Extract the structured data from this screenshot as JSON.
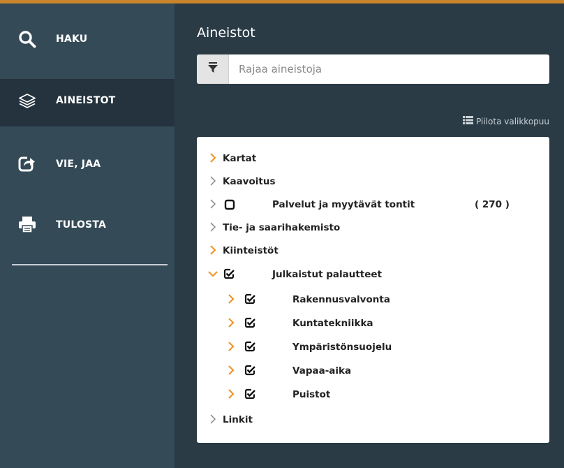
{
  "sidebar": {
    "items": [
      {
        "label": "HAKU",
        "icon": "search-icon"
      },
      {
        "label": "AINEISTOT",
        "icon": "layers-icon",
        "active": true
      },
      {
        "label": "VIE, JAA",
        "icon": "share-icon"
      },
      {
        "label": "TULOSTA",
        "icon": "print-icon"
      }
    ]
  },
  "main": {
    "title": "Aineistot",
    "filter": {
      "placeholder": "Rajaa aineistoja",
      "value": "",
      "icon": "filter-icon"
    },
    "hide_tree_label": "Piilota valikkopuu",
    "hide_tree_icon": "list-icon",
    "tree": [
      {
        "label": "Kartat",
        "expanded": false,
        "chevron": "orange"
      },
      {
        "label": "Kaavoitus",
        "expanded": false,
        "chevron": "gray"
      },
      {
        "label": "Palvelut ja myytävät tontit",
        "count": "( 270 )",
        "checked": false,
        "chevron": "gray"
      },
      {
        "label": "Tie- ja saarihakemisto",
        "chevron": "gray"
      },
      {
        "label": "Kiinteistöt",
        "chevron": "orange"
      },
      {
        "label": "Julkaistut palautteet",
        "expanded": true,
        "checked": true,
        "chevron": "orange",
        "children": [
          {
            "label": "Rakennusvalvonta",
            "checked": true
          },
          {
            "label": "Kuntatekniikka",
            "checked": true
          },
          {
            "label": "Ympäristönsuojelu",
            "checked": true
          },
          {
            "label": "Vapaa-aika",
            "checked": true
          },
          {
            "label": "Puistot",
            "checked": true
          }
        ]
      },
      {
        "label": "Linkit",
        "chevron": "gray"
      }
    ]
  },
  "colors": {
    "accent_orange": "#f0952b",
    "sidebar_bg": "#344a57",
    "sidebar_active_bg": "#24333d",
    "main_bg": "#2a3b46",
    "top_border": "#c8852b"
  }
}
